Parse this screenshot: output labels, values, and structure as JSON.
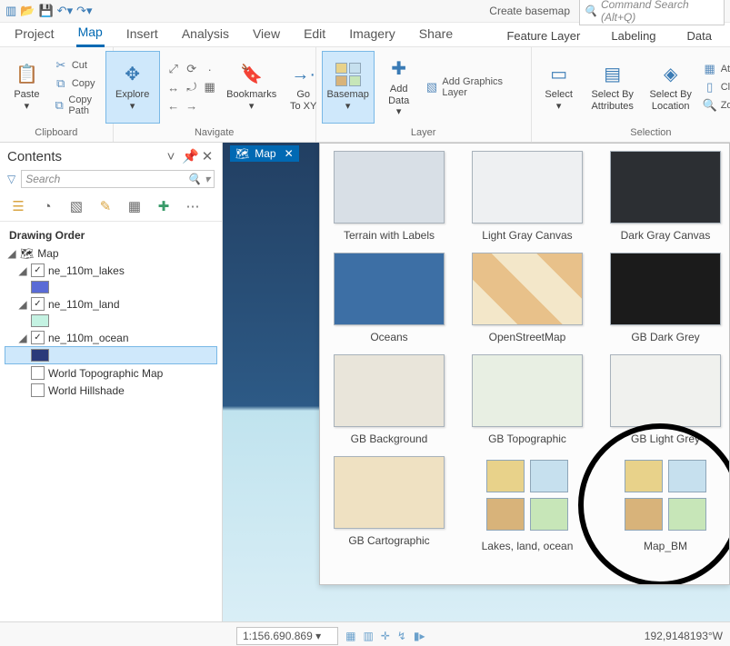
{
  "qat": {
    "create": "Create basemap",
    "search_ph": "Command Search (Alt+Q)"
  },
  "tabs": {
    "project": "Project",
    "map": "Map",
    "insert": "Insert",
    "analysis": "Analysis",
    "view": "View",
    "edit": "Edit",
    "imagery": "Imagery",
    "share": "Share",
    "feature": "Feature Layer",
    "labeling": "Labeling",
    "data": "Data"
  },
  "ribbon": {
    "paste": "Paste",
    "cut": "Cut",
    "copy": "Copy",
    "copypath": "Copy Path",
    "clipboard": "Clipboard",
    "explore": "Explore",
    "bookmarks": "Bookmarks",
    "goto": "Go\nTo XY",
    "navigate": "Navigate",
    "basemap": "Basemap",
    "adddata": "Add\nData",
    "addgraphics": "Add Graphics Layer",
    "layer": "Layer",
    "select": "Select",
    "selattr": "Select By\nAttributes",
    "selloc": "Select By\nLocation",
    "attributes": "Attributes",
    "clear": "Clear",
    "zoomto": "Zoom To",
    "selection": "Selection"
  },
  "contents": {
    "title": "Contents",
    "search_ph": "Search",
    "drawing": "Drawing Order",
    "map": "Map",
    "layers": [
      {
        "name": "ne_110m_lakes",
        "color": "#5a6bd6",
        "checked": true
      },
      {
        "name": "ne_110m_land",
        "color": "#c4f2e2",
        "checked": true
      },
      {
        "name": "ne_110m_ocean",
        "color": "#2b3a7a",
        "checked": true,
        "selected": true
      },
      {
        "name": "World Topographic Map",
        "checked": false
      },
      {
        "name": "World Hillshade",
        "checked": false
      }
    ]
  },
  "maptab": "Map",
  "basemaps": {
    "r1": [
      "Terrain with Labels",
      "Light Gray Canvas",
      "Dark Gray Canvas"
    ],
    "r2": [
      "Oceans",
      "OpenStreetMap",
      "GB Dark Grey"
    ],
    "r3": [
      "GB Background",
      "GB Topographic",
      "GB Light Grey"
    ],
    "r4": [
      "GB Cartographic",
      "Lakes, land, ocean",
      "Map_BM"
    ]
  },
  "status": {
    "scale": "1:156.690.869",
    "coord": "192,9148193°W"
  }
}
